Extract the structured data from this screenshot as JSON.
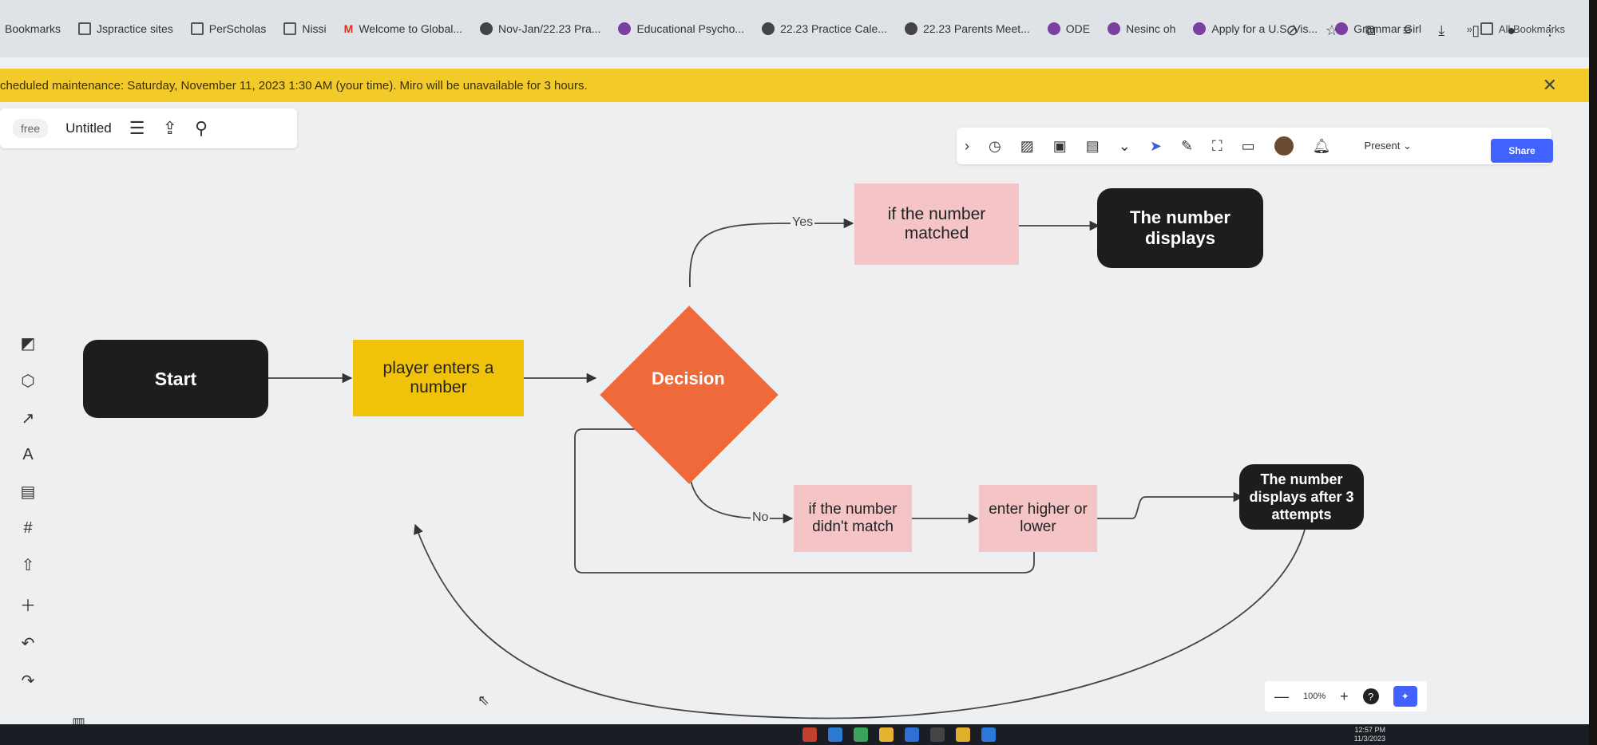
{
  "bookmarks_bar": {
    "items": [
      {
        "label": "Bookmarks",
        "icon": "none"
      },
      {
        "label": "Jspractice sites",
        "icon": "folder-icon"
      },
      {
        "label": "PerScholas",
        "icon": "folder-icon"
      },
      {
        "label": "Nissi",
        "icon": "folder-icon"
      },
      {
        "label": "Welcome to Global...",
        "icon": "gmail-icon"
      },
      {
        "label": "Nov-Jan/22.23 Pra...",
        "icon": "globe-icon"
      },
      {
        "label": "Educational Psycho...",
        "icon": "site-icon"
      },
      {
        "label": "22.23 Practice Cale...",
        "icon": "globe-icon"
      },
      {
        "label": "22.23 Parents Meet...",
        "icon": "globe-icon"
      },
      {
        "label": "ODE",
        "icon": "site-icon"
      },
      {
        "label": "Nesinc oh",
        "icon": "site-icon"
      },
      {
        "label": "Apply for a U.S. Vis...",
        "icon": "site-icon"
      },
      {
        "label": "Grammar Girl",
        "icon": "site-icon"
      }
    ],
    "overflow": "»",
    "all_bookmarks": "All Bookmarks"
  },
  "banner": {
    "text": "cheduled maintenance: Saturday, November 11, 2023 1:30 AM (your time). Miro will be unavailable for 3 hours.",
    "close": "✕",
    "color": "#f2cb2a"
  },
  "board": {
    "plan_badge": "free",
    "title": "Untitled"
  },
  "toolbar": {
    "present_label": "Present",
    "share_label": "Share"
  },
  "flowchart": {
    "start": "Start",
    "input": "player enters a number",
    "decision": "Decision",
    "yes_label": "Yes",
    "no_label": "No",
    "matched": "if the number matched",
    "displays": "The number displays",
    "not_matched": "if the number didn't match",
    "higher_lower": "enter higher or lower",
    "after_attempts": "The number displays after 3 attempts",
    "colors": {
      "dark": "#1f1c1c",
      "yellow": "#f0c30a",
      "orange": "#ee6a3a",
      "pink": "#f4c4c6"
    }
  },
  "zoom": {
    "minus": "—",
    "level": "100%",
    "plus": "+",
    "help": "?"
  },
  "taskbar": {
    "time": "12:57 PM",
    "date": "11/3/2023"
  }
}
